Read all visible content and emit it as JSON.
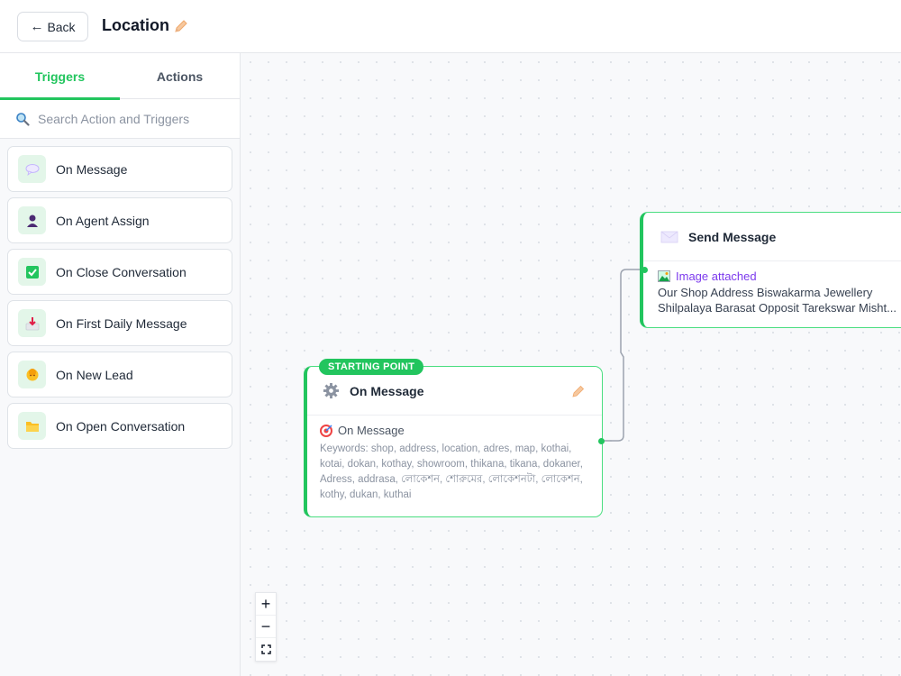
{
  "header": {
    "back_label": "Back",
    "title": "Location"
  },
  "sidebar": {
    "tabs": [
      {
        "label": "Triggers",
        "active": true
      },
      {
        "label": "Actions",
        "active": false
      }
    ],
    "search": {
      "placeholder": "Search Action and Triggers"
    },
    "items": [
      {
        "label": "On Message",
        "icon": "speech-balloon-icon"
      },
      {
        "label": "On Agent Assign",
        "icon": "person-silhouette-icon"
      },
      {
        "label": "On Close Conversation",
        "icon": "check-box-icon"
      },
      {
        "label": "On First Daily Message",
        "icon": "inbox-tray-icon"
      },
      {
        "label": "On New Lead",
        "icon": "person-face-icon"
      },
      {
        "label": "On Open Conversation",
        "icon": "open-folder-icon"
      }
    ]
  },
  "canvas": {
    "start_node": {
      "badge": "STARTING POINT",
      "title": "On Message",
      "trigger": "On Message",
      "keywords": "Keywords: shop, address, location, adres, map, kothai, kotai, dokan, kothay, showroom, thikana, tikana, dokaner, Adress, addrasa, লোকেশন, শোরুমের, লোকেশনটা, লোকেশন, kothy, dukan, kuthai"
    },
    "send_node": {
      "title": "Send Message",
      "attachment": "Image attached",
      "message_line1": "Our Shop Address Biswakarma Jewellery",
      "message_line2": "Shilpalaya Barasat Opposit Tarekswar Misht..."
    },
    "zoom": {
      "in": "+",
      "out": "−",
      "fit": "⛶"
    }
  },
  "colors": {
    "accent": "#22c55e",
    "attachment": "#7c3aed"
  }
}
